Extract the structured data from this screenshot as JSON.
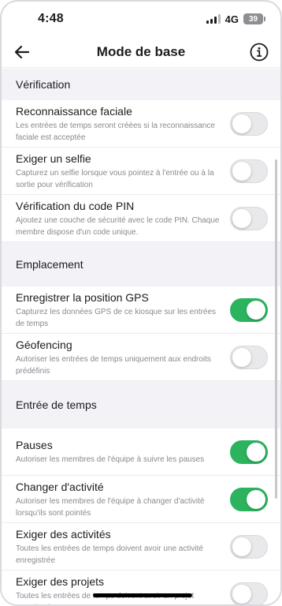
{
  "status": {
    "time": "4:48",
    "network": "4G",
    "battery": "39"
  },
  "nav": {
    "title": "Mode de base"
  },
  "sections": [
    {
      "title": "Vérification",
      "items": [
        {
          "title": "Reconnaissance faciale",
          "desc": "Les entrées de temps seront créées si la reconnaissance faciale est acceptée",
          "on": false
        },
        {
          "title": "Exiger un selfie",
          "desc": "Capturez un selfie lorsque vous pointez à l'entrée ou à la sortie pour vérification",
          "on": false
        },
        {
          "title": "Vérification du code PIN",
          "desc": "Ajoutez une couche de sécurité avec le code PIN. Chaque membre dispose d'un code unique.",
          "on": false
        }
      ]
    },
    {
      "title": "Emplacement",
      "items": [
        {
          "title": "Enregistrer la position GPS",
          "desc": "Capturez les données GPS de ce kiosque sur les entrées de temps",
          "on": true
        },
        {
          "title": "Géofencing",
          "desc": "Autoriser les entrées de temps uniquement aux endroits prédéfinis",
          "on": false
        }
      ]
    },
    {
      "title": "Entrée de temps",
      "items": [
        {
          "title": "Pauses",
          "desc": "Autoriser les membres de l'équipe à suivre les pauses",
          "on": true
        },
        {
          "title": "Changer d'activité",
          "desc": "Autoriser les membres de l'équipe à changer d'activité lorsqu'ils sont pointés",
          "on": true
        },
        {
          "title": "Exiger des activités",
          "desc": "Toutes les entrées de temps doivent avoir une activité enregistrée",
          "on": false
        },
        {
          "title": "Exiger des projets",
          "desc": "Toutes les entrées de temps doivent avoir un projet enregistré",
          "on": false
        }
      ]
    }
  ],
  "colors": {
    "toggle_on": "#2bb35e",
    "toggle_off": "#e9e9eb",
    "background": "#f2f2f7"
  }
}
